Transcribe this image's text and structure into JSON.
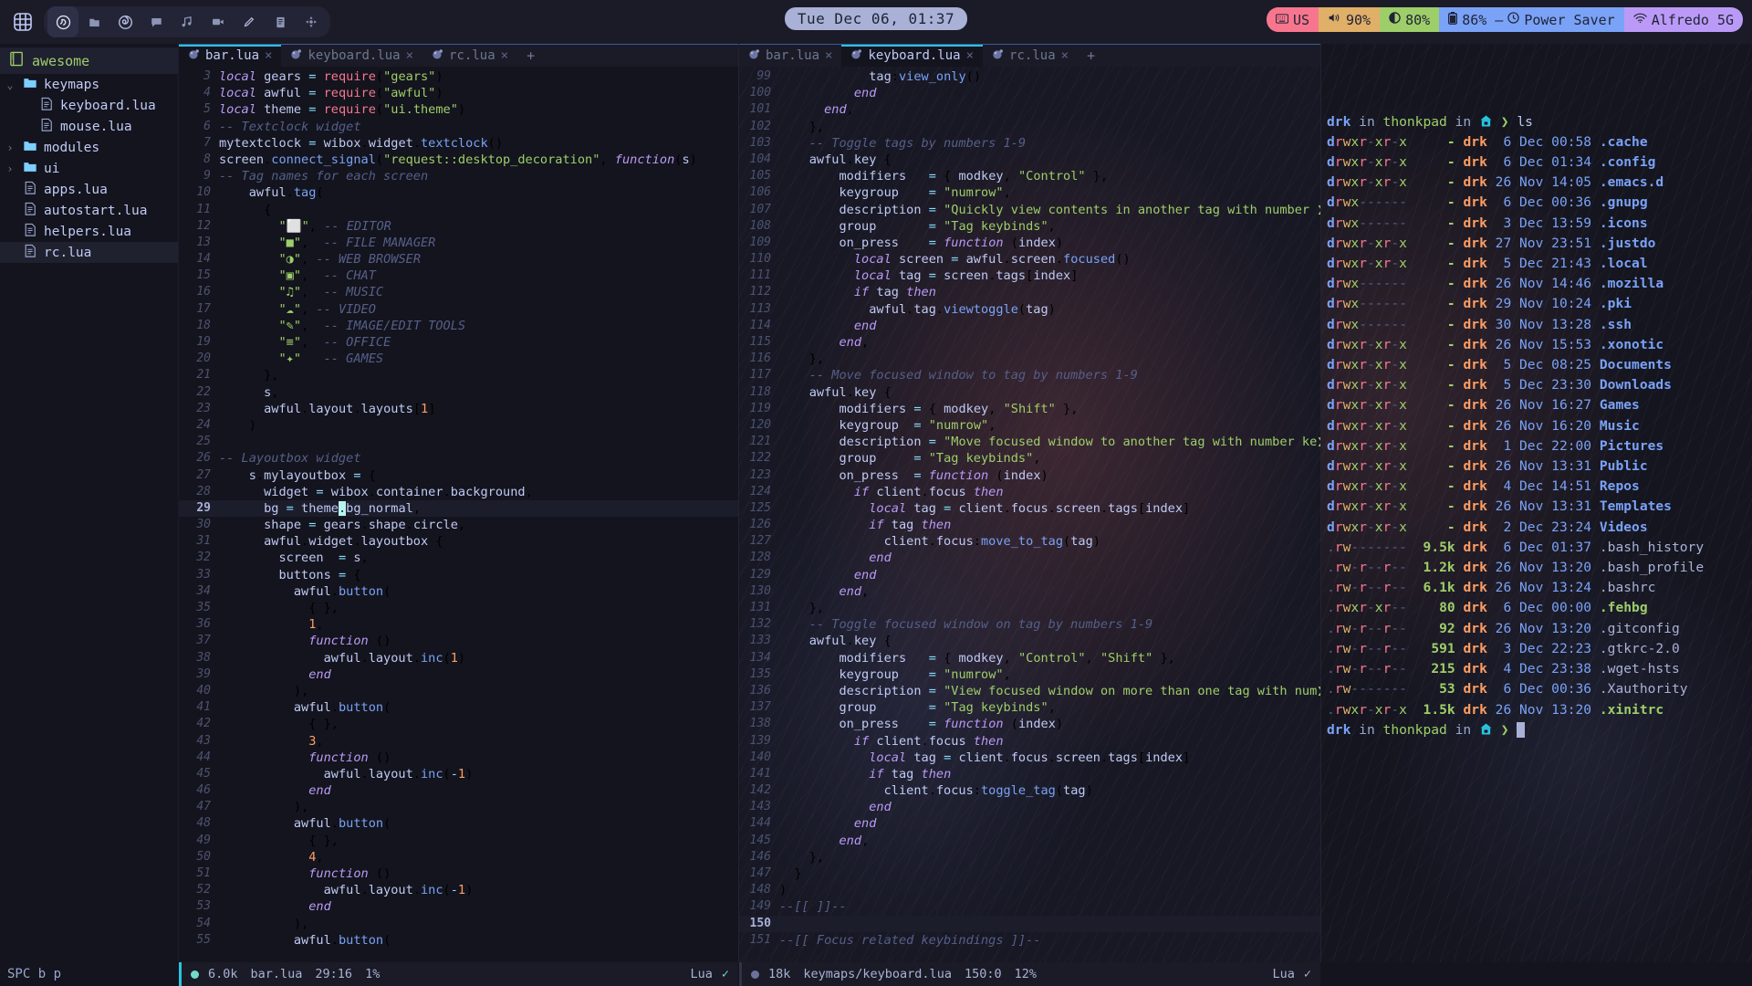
{
  "topbar": {
    "launcher_icon": "grid-apps-icon",
    "tags": [
      {
        "glyph": "☰",
        "name": "emacs-icon"
      },
      {
        "glyph": "■",
        "name": "file-manager-icon"
      },
      {
        "glyph": "◑",
        "name": "firefox-icon"
      },
      {
        "glyph": "⬜",
        "name": "chat-icon"
      },
      {
        "glyph": "♫",
        "name": "music-icon"
      },
      {
        "glyph": "▶",
        "name": "video-icon"
      },
      {
        "glyph": "✎",
        "name": "pencil-icon"
      },
      {
        "glyph": "≡",
        "name": "office-icon"
      },
      {
        "glyph": "✦",
        "name": "games-icon"
      }
    ],
    "clock": "Tue Dec 06, 01:37",
    "status": {
      "keyboard_layout": "US",
      "volume": "90%",
      "brightness": "80%",
      "battery": "86% –",
      "power_profile": "Power Saver",
      "wifi_ssid": "Alfredo 5G"
    },
    "colors": {
      "keyboard": "#f7768e",
      "volume": "#e0af68",
      "brightness": "#9ece6a",
      "battery": "#7aa2f7",
      "wifi": "#bb9af7",
      "clock_bg": "#a9b1d6",
      "accent": "#2ac3de"
    }
  },
  "filetree": {
    "root": "awesome",
    "items": [
      {
        "label": "keymaps",
        "kind": "folder",
        "chevron": "⌄",
        "depth": 0,
        "selected": false
      },
      {
        "label": "keyboard.lua",
        "kind": "file",
        "chevron": "",
        "depth": 1,
        "selected": false
      },
      {
        "label": "mouse.lua",
        "kind": "file",
        "chevron": "",
        "depth": 1,
        "selected": false
      },
      {
        "label": "modules",
        "kind": "folder",
        "chevron": "›",
        "depth": 0,
        "selected": false
      },
      {
        "label": "ui",
        "kind": "folder",
        "chevron": "›",
        "depth": 0,
        "selected": false
      },
      {
        "label": "apps.lua",
        "kind": "file",
        "chevron": "",
        "depth": 0,
        "selected": false
      },
      {
        "label": "autostart.lua",
        "kind": "file",
        "chevron": "",
        "depth": 0,
        "selected": false
      },
      {
        "label": "helpers.lua",
        "kind": "file",
        "chevron": "",
        "depth": 0,
        "selected": false
      },
      {
        "label": "rc.lua",
        "kind": "file",
        "chevron": "",
        "depth": 0,
        "selected": true
      }
    ]
  },
  "left_pane": {
    "tabs": [
      {
        "label": "bar.lua",
        "active": true,
        "close": "×"
      },
      {
        "label": "keyboard.lua",
        "active": false,
        "close": "×"
      },
      {
        "label": "rc.lua",
        "active": false,
        "close": "×"
      }
    ],
    "new_tab": "+",
    "first_line": 3,
    "cursor_line": 29,
    "lines": [
      "local gears = require(\"gears\")",
      "local awful = require(\"awful\")",
      "local theme = require(\"ui.theme\")",
      "-- Textclock widget",
      "mytextclock = wibox.widget.textclock()",
      "screen.connect_signal(\"request::desktop_decoration\", function(s)",
      "-- Tag names for each screen",
      "    awful.tag(",
      "      {",
      "        \"⬜\", -- EDITOR",
      "        \"■\",  -- FILE MANAGER",
      "        \"◑\", -- WEB BROWSER",
      "        \"▣\",  -- CHAT",
      "        \"♫\",  -- MUSIC",
      "        \"☁\", -- VIDEO",
      "        \"✎\",  -- IMAGE/EDIT TOOLS",
      "        \"≡\",  -- OFFICE",
      "        \"✦\"   -- GAMES",
      "      },",
      "      s,",
      "      awful.layout.layouts[1]",
      "    )",
      "",
      "-- Layoutbox widget",
      "    s.mylayoutbox = {",
      "      widget = wibox.container.background,",
      "      bg = theme.bg_normal,",
      "      shape = gears.shape.circle,",
      "      awful.widget.layoutbox {",
      "        screen  = s,",
      "        buttons = {",
      "          awful.button(",
      "            { },",
      "            1,",
      "            function ()",
      "              awful.layout.inc(1)",
      "            end",
      "          ),",
      "          awful.button(",
      "            { },",
      "            3,",
      "            function ()",
      "              awful.layout.inc(-1)",
      "            end",
      "          ),",
      "          awful.button(",
      "            { },",
      "            4,",
      "            function ()",
      "              awful.layout.inc(-1)",
      "            end",
      "          ),",
      "          awful.button("
    ],
    "statusline": {
      "size": "6.0k",
      "filename": "bar.lua",
      "position": "29:16",
      "percent": "1%",
      "language": "Lua",
      "check": "✓"
    }
  },
  "right_pane": {
    "tabs": [
      {
        "label": "bar.lua",
        "active": false,
        "close": "×"
      },
      {
        "label": "keyboard.lua",
        "active": true,
        "close": "×"
      },
      {
        "label": "rc.lua",
        "active": false,
        "close": "×"
      }
    ],
    "new_tab": "+",
    "first_line": 99,
    "cursor_line": 150,
    "lines": [
      "            tag:view_only()",
      "          end",
      "      end,",
      "    },",
      "    -- Toggle tags by numbers 1-9",
      "    awful.key {",
      "        modifiers   = { modkey, \"Control\" },",
      "        keygroup    = \"numrow\",",
      "        description = \"Quickly view contents in another tag with number ❯",
      "        group       = \"Tag keybinds\",",
      "        on_press    = function (index)",
      "          local screen = awful.screen.focused()",
      "          local tag = screen.tags[index]",
      "          if tag then",
      "            awful.tag.viewtoggle(tag)",
      "          end",
      "        end,",
      "    },",
      "    -- Move focused window to tag by numbers 1-9",
      "    awful.key {",
      "        modifiers = { modkey, \"Shift\" },",
      "        keygroup  = \"numrow\",",
      "        description = \"Move focused window to another tag with number ke❯",
      "        group     = \"Tag keybinds\",",
      "        on_press  = function (index)",
      "          if client.focus then",
      "            local tag = client.focus.screen.tags[index]",
      "            if tag then",
      "              client.focus:move_to_tag(tag)",
      "            end",
      "          end",
      "        end,",
      "    },",
      "    -- Toggle focused window on tag by numbers 1-9",
      "    awful.key {",
      "        modifiers   = { modkey, \"Control\", \"Shift\" },",
      "        keygroup    = \"numrow\",",
      "        description = \"View focused window on more than one tag with num❯",
      "        group       = \"Tag keybinds\",",
      "        on_press    = function (index)",
      "          if client.focus then",
      "            local tag = client.focus.screen.tags[index]",
      "            if tag then",
      "              client.focus:toggle_tag(tag)",
      "            end",
      "          end",
      "        end,",
      "    },",
      "  }",
      ")",
      "--[[ ]]--",
      "",
      "--[[ Focus related keybindings ]]--"
    ],
    "statusline": {
      "size": "18k",
      "filename": "keymaps/keyboard.lua",
      "position": "150:0",
      "percent": "12%",
      "language": "Lua",
      "check": "✓"
    }
  },
  "terminal": {
    "prompt": {
      "user": "drk",
      "in1": "in",
      "host": "thonkpad",
      "in2": "in",
      "home_icon": "home-icon",
      "arrow": "❯",
      "command": "ls"
    },
    "entries": [
      {
        "perms": "drwxr-xr-x",
        "size": "-",
        "owner": "drk",
        "day": " 6",
        "month": "Dec",
        "time": "00:58",
        "name": ".cache",
        "type": "dir"
      },
      {
        "perms": "drwxr-xr-x",
        "size": "-",
        "owner": "drk",
        "day": " 6",
        "month": "Dec",
        "time": "01:34",
        "name": ".config",
        "type": "dir"
      },
      {
        "perms": "drwxr-xr-x",
        "size": "-",
        "owner": "drk",
        "day": "26",
        "month": "Nov",
        "time": "14:05",
        "name": ".emacs.d",
        "type": "dir"
      },
      {
        "perms": "drwx------",
        "size": "-",
        "owner": "drk",
        "day": " 6",
        "month": "Dec",
        "time": "00:36",
        "name": ".gnupg",
        "type": "dir"
      },
      {
        "perms": "drwx------",
        "size": "-",
        "owner": "drk",
        "day": " 3",
        "month": "Dec",
        "time": "13:59",
        "name": ".icons",
        "type": "dir"
      },
      {
        "perms": "drwxr-xr-x",
        "size": "-",
        "owner": "drk",
        "day": "27",
        "month": "Nov",
        "time": "23:51",
        "name": ".justdo",
        "type": "dir"
      },
      {
        "perms": "drwxr-xr-x",
        "size": "-",
        "owner": "drk",
        "day": " 5",
        "month": "Dec",
        "time": "21:43",
        "name": ".local",
        "type": "dir"
      },
      {
        "perms": "drwx------",
        "size": "-",
        "owner": "drk",
        "day": "26",
        "month": "Nov",
        "time": "14:46",
        "name": ".mozilla",
        "type": "dir"
      },
      {
        "perms": "drwx------",
        "size": "-",
        "owner": "drk",
        "day": "29",
        "month": "Nov",
        "time": "10:24",
        "name": ".pki",
        "type": "dir"
      },
      {
        "perms": "drwx------",
        "size": "-",
        "owner": "drk",
        "day": "30",
        "month": "Nov",
        "time": "13:28",
        "name": ".ssh",
        "type": "dir"
      },
      {
        "perms": "drwxr-xr-x",
        "size": "-",
        "owner": "drk",
        "day": "26",
        "month": "Nov",
        "time": "15:53",
        "name": ".xonotic",
        "type": "dir"
      },
      {
        "perms": "drwxr-xr-x",
        "size": "-",
        "owner": "drk",
        "day": " 5",
        "month": "Dec",
        "time": "08:25",
        "name": "Documents",
        "type": "dir"
      },
      {
        "perms": "drwxr-xr-x",
        "size": "-",
        "owner": "drk",
        "day": " 5",
        "month": "Dec",
        "time": "23:30",
        "name": "Downloads",
        "type": "dir"
      },
      {
        "perms": "drwxr-xr-x",
        "size": "-",
        "owner": "drk",
        "day": "26",
        "month": "Nov",
        "time": "16:27",
        "name": "Games",
        "type": "dir"
      },
      {
        "perms": "drwxr-xr-x",
        "size": "-",
        "owner": "drk",
        "day": "26",
        "month": "Nov",
        "time": "16:20",
        "name": "Music",
        "type": "dir"
      },
      {
        "perms": "drwxr-xr-x",
        "size": "-",
        "owner": "drk",
        "day": " 1",
        "month": "Dec",
        "time": "22:00",
        "name": "Pictures",
        "type": "dir"
      },
      {
        "perms": "drwxr-xr-x",
        "size": "-",
        "owner": "drk",
        "day": "26",
        "month": "Nov",
        "time": "13:31",
        "name": "Public",
        "type": "dir"
      },
      {
        "perms": "drwxr-xr-x",
        "size": "-",
        "owner": "drk",
        "day": " 4",
        "month": "Dec",
        "time": "14:51",
        "name": "Repos",
        "type": "dir"
      },
      {
        "perms": "drwxr-xr-x",
        "size": "-",
        "owner": "drk",
        "day": "26",
        "month": "Nov",
        "time": "13:31",
        "name": "Templates",
        "type": "dir"
      },
      {
        "perms": "drwxr-xr-x",
        "size": "-",
        "owner": "drk",
        "day": " 2",
        "month": "Dec",
        "time": "23:24",
        "name": "Videos",
        "type": "dir"
      },
      {
        "perms": ".rw-------",
        "size": "9.5k",
        "owner": "drk",
        "day": " 6",
        "month": "Dec",
        "time": "01:37",
        "name": ".bash_history",
        "type": "file"
      },
      {
        "perms": ".rw-r--r--",
        "size": "1.2k",
        "owner": "drk",
        "day": "26",
        "month": "Nov",
        "time": "13:20",
        "name": ".bash_profile",
        "type": "file"
      },
      {
        "perms": ".rw-r--r--",
        "size": "6.1k",
        "owner": "drk",
        "day": "26",
        "month": "Nov",
        "time": "13:24",
        "name": ".bashrc",
        "type": "file"
      },
      {
        "perms": ".rwxr-xr--",
        "size": "  80",
        "owner": "drk",
        "day": " 6",
        "month": "Dec",
        "time": "00:00",
        "name": ".fehbg",
        "type": "exec"
      },
      {
        "perms": ".rw-r--r--",
        "size": "  92",
        "owner": "drk",
        "day": "26",
        "month": "Nov",
        "time": "13:20",
        "name": ".gitconfig",
        "type": "file"
      },
      {
        "perms": ".rw-r--r--",
        "size": " 591",
        "owner": "drk",
        "day": " 3",
        "month": "Dec",
        "time": "22:23",
        "name": ".gtkrc-2.0",
        "type": "file"
      },
      {
        "perms": ".rw-r--r--",
        "size": " 215",
        "owner": "drk",
        "day": " 4",
        "month": "Dec",
        "time": "23:38",
        "name": ".wget-hsts",
        "type": "file"
      },
      {
        "perms": ".rw-------",
        "size": "  53",
        "owner": "drk",
        "day": " 6",
        "month": "Dec",
        "time": "00:36",
        "name": ".Xauthority",
        "type": "file"
      },
      {
        "perms": ".rwxr-xr-x",
        "size": "1.5k",
        "owner": "drk",
        "day": "26",
        "month": "Nov",
        "time": "13:20",
        "name": ".xinitrc",
        "type": "exec"
      }
    ]
  },
  "bottombar": {
    "text": "SPC b p"
  }
}
